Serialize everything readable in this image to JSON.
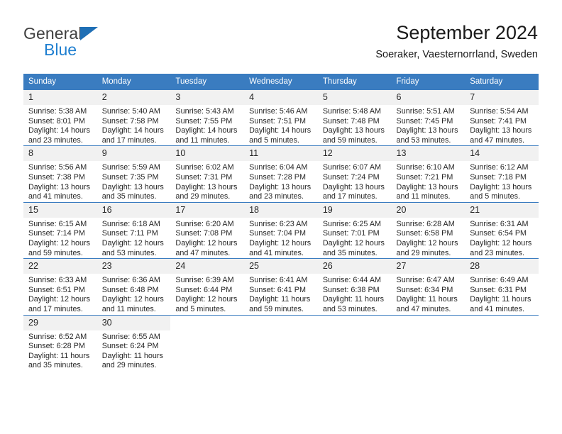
{
  "brand": {
    "name_part1": "General",
    "name_part2": "Blue",
    "flag_icon": "triangle-flag-icon",
    "accent_color": "#1f7fd0"
  },
  "header": {
    "title": "September 2024",
    "subtitle": "Soeraker, Vaesternorrland, Sweden"
  },
  "calendar": {
    "header_color": "#3a7cc0",
    "daynum_band_color": "#f1f1f1",
    "weekday_headers": [
      "Sunday",
      "Monday",
      "Tuesday",
      "Wednesday",
      "Thursday",
      "Friday",
      "Saturday"
    ],
    "weeks": [
      [
        {
          "day": "1",
          "sunrise": "Sunrise: 5:38 AM",
          "sunset": "Sunset: 8:01 PM",
          "daylight1": "Daylight: 14 hours",
          "daylight2": "and 23 minutes."
        },
        {
          "day": "2",
          "sunrise": "Sunrise: 5:40 AM",
          "sunset": "Sunset: 7:58 PM",
          "daylight1": "Daylight: 14 hours",
          "daylight2": "and 17 minutes."
        },
        {
          "day": "3",
          "sunrise": "Sunrise: 5:43 AM",
          "sunset": "Sunset: 7:55 PM",
          "daylight1": "Daylight: 14 hours",
          "daylight2": "and 11 minutes."
        },
        {
          "day": "4",
          "sunrise": "Sunrise: 5:46 AM",
          "sunset": "Sunset: 7:51 PM",
          "daylight1": "Daylight: 14 hours",
          "daylight2": "and 5 minutes."
        },
        {
          "day": "5",
          "sunrise": "Sunrise: 5:48 AM",
          "sunset": "Sunset: 7:48 PM",
          "daylight1": "Daylight: 13 hours",
          "daylight2": "and 59 minutes."
        },
        {
          "day": "6",
          "sunrise": "Sunrise: 5:51 AM",
          "sunset": "Sunset: 7:45 PM",
          "daylight1": "Daylight: 13 hours",
          "daylight2": "and 53 minutes."
        },
        {
          "day": "7",
          "sunrise": "Sunrise: 5:54 AM",
          "sunset": "Sunset: 7:41 PM",
          "daylight1": "Daylight: 13 hours",
          "daylight2": "and 47 minutes."
        }
      ],
      [
        {
          "day": "8",
          "sunrise": "Sunrise: 5:56 AM",
          "sunset": "Sunset: 7:38 PM",
          "daylight1": "Daylight: 13 hours",
          "daylight2": "and 41 minutes."
        },
        {
          "day": "9",
          "sunrise": "Sunrise: 5:59 AM",
          "sunset": "Sunset: 7:35 PM",
          "daylight1": "Daylight: 13 hours",
          "daylight2": "and 35 minutes."
        },
        {
          "day": "10",
          "sunrise": "Sunrise: 6:02 AM",
          "sunset": "Sunset: 7:31 PM",
          "daylight1": "Daylight: 13 hours",
          "daylight2": "and 29 minutes."
        },
        {
          "day": "11",
          "sunrise": "Sunrise: 6:04 AM",
          "sunset": "Sunset: 7:28 PM",
          "daylight1": "Daylight: 13 hours",
          "daylight2": "and 23 minutes."
        },
        {
          "day": "12",
          "sunrise": "Sunrise: 6:07 AM",
          "sunset": "Sunset: 7:24 PM",
          "daylight1": "Daylight: 13 hours",
          "daylight2": "and 17 minutes."
        },
        {
          "day": "13",
          "sunrise": "Sunrise: 6:10 AM",
          "sunset": "Sunset: 7:21 PM",
          "daylight1": "Daylight: 13 hours",
          "daylight2": "and 11 minutes."
        },
        {
          "day": "14",
          "sunrise": "Sunrise: 6:12 AM",
          "sunset": "Sunset: 7:18 PM",
          "daylight1": "Daylight: 13 hours",
          "daylight2": "and 5 minutes."
        }
      ],
      [
        {
          "day": "15",
          "sunrise": "Sunrise: 6:15 AM",
          "sunset": "Sunset: 7:14 PM",
          "daylight1": "Daylight: 12 hours",
          "daylight2": "and 59 minutes."
        },
        {
          "day": "16",
          "sunrise": "Sunrise: 6:18 AM",
          "sunset": "Sunset: 7:11 PM",
          "daylight1": "Daylight: 12 hours",
          "daylight2": "and 53 minutes."
        },
        {
          "day": "17",
          "sunrise": "Sunrise: 6:20 AM",
          "sunset": "Sunset: 7:08 PM",
          "daylight1": "Daylight: 12 hours",
          "daylight2": "and 47 minutes."
        },
        {
          "day": "18",
          "sunrise": "Sunrise: 6:23 AM",
          "sunset": "Sunset: 7:04 PM",
          "daylight1": "Daylight: 12 hours",
          "daylight2": "and 41 minutes."
        },
        {
          "day": "19",
          "sunrise": "Sunrise: 6:25 AM",
          "sunset": "Sunset: 7:01 PM",
          "daylight1": "Daylight: 12 hours",
          "daylight2": "and 35 minutes."
        },
        {
          "day": "20",
          "sunrise": "Sunrise: 6:28 AM",
          "sunset": "Sunset: 6:58 PM",
          "daylight1": "Daylight: 12 hours",
          "daylight2": "and 29 minutes."
        },
        {
          "day": "21",
          "sunrise": "Sunrise: 6:31 AM",
          "sunset": "Sunset: 6:54 PM",
          "daylight1": "Daylight: 12 hours",
          "daylight2": "and 23 minutes."
        }
      ],
      [
        {
          "day": "22",
          "sunrise": "Sunrise: 6:33 AM",
          "sunset": "Sunset: 6:51 PM",
          "daylight1": "Daylight: 12 hours",
          "daylight2": "and 17 minutes."
        },
        {
          "day": "23",
          "sunrise": "Sunrise: 6:36 AM",
          "sunset": "Sunset: 6:48 PM",
          "daylight1": "Daylight: 12 hours",
          "daylight2": "and 11 minutes."
        },
        {
          "day": "24",
          "sunrise": "Sunrise: 6:39 AM",
          "sunset": "Sunset: 6:44 PM",
          "daylight1": "Daylight: 12 hours",
          "daylight2": "and 5 minutes."
        },
        {
          "day": "25",
          "sunrise": "Sunrise: 6:41 AM",
          "sunset": "Sunset: 6:41 PM",
          "daylight1": "Daylight: 11 hours",
          "daylight2": "and 59 minutes."
        },
        {
          "day": "26",
          "sunrise": "Sunrise: 6:44 AM",
          "sunset": "Sunset: 6:38 PM",
          "daylight1": "Daylight: 11 hours",
          "daylight2": "and 53 minutes."
        },
        {
          "day": "27",
          "sunrise": "Sunrise: 6:47 AM",
          "sunset": "Sunset: 6:34 PM",
          "daylight1": "Daylight: 11 hours",
          "daylight2": "and 47 minutes."
        },
        {
          "day": "28",
          "sunrise": "Sunrise: 6:49 AM",
          "sunset": "Sunset: 6:31 PM",
          "daylight1": "Daylight: 11 hours",
          "daylight2": "and 41 minutes."
        }
      ],
      [
        {
          "day": "29",
          "sunrise": "Sunrise: 6:52 AM",
          "sunset": "Sunset: 6:28 PM",
          "daylight1": "Daylight: 11 hours",
          "daylight2": "and 35 minutes."
        },
        {
          "day": "30",
          "sunrise": "Sunrise: 6:55 AM",
          "sunset": "Sunset: 6:24 PM",
          "daylight1": "Daylight: 11 hours",
          "daylight2": "and 29 minutes."
        },
        {
          "day": "",
          "sunrise": "",
          "sunset": "",
          "daylight1": "",
          "daylight2": ""
        },
        {
          "day": "",
          "sunrise": "",
          "sunset": "",
          "daylight1": "",
          "daylight2": ""
        },
        {
          "day": "",
          "sunrise": "",
          "sunset": "",
          "daylight1": "",
          "daylight2": ""
        },
        {
          "day": "",
          "sunrise": "",
          "sunset": "",
          "daylight1": "",
          "daylight2": ""
        },
        {
          "day": "",
          "sunrise": "",
          "sunset": "",
          "daylight1": "",
          "daylight2": ""
        }
      ]
    ]
  }
}
